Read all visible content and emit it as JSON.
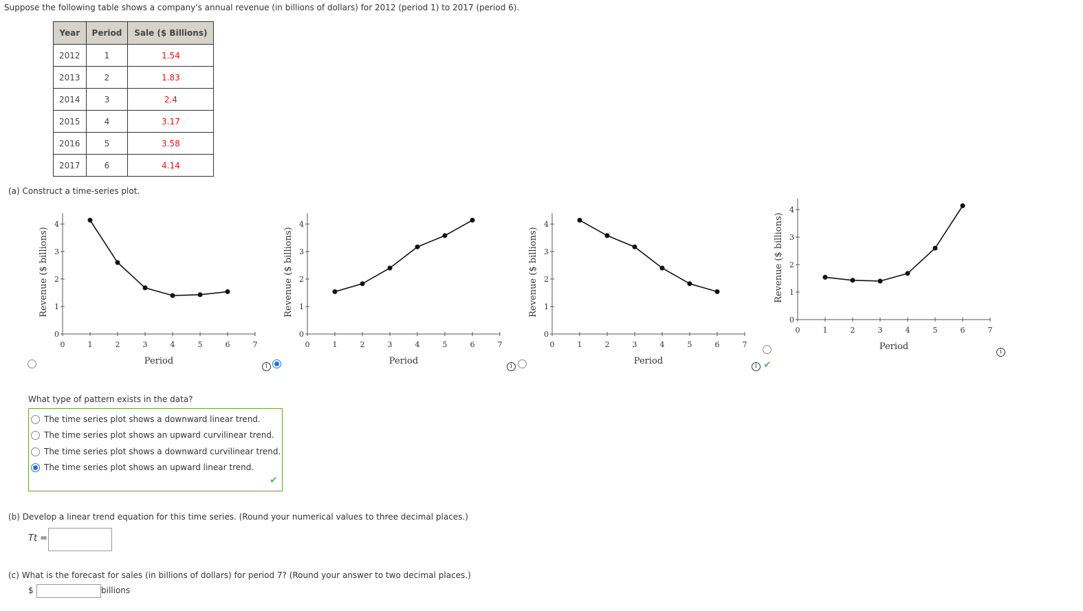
{
  "intro": "Suppose the following table shows a company's annual revenue (in billions of dollars) for 2012 (period 1) to 2017 (period 6).",
  "table": {
    "headers": [
      "Year",
      "Period",
      "Sale ($ Billions)"
    ],
    "rows": [
      [
        "2012",
        "1",
        "1.54"
      ],
      [
        "2013",
        "2",
        "1.83"
      ],
      [
        "2014",
        "3",
        "2.4"
      ],
      [
        "2015",
        "4",
        "3.17"
      ],
      [
        "2016",
        "5",
        "3.58"
      ],
      [
        "2017",
        "6",
        "4.14"
      ]
    ]
  },
  "part_a": {
    "label": "(a)  Construct a time-series plot.",
    "question": "What type of pattern exists in the data?",
    "choices": [
      {
        "text": "The time series plot shows a downward linear trend.",
        "selected": false
      },
      {
        "text": "The time series plot shows an upward curvilinear trend.",
        "selected": false
      },
      {
        "text": "The time series plot shows a downward curvilinear trend.",
        "selected": false
      },
      {
        "text": "The time series plot shows an upward linear trend.",
        "selected": true
      }
    ],
    "result": "correct",
    "plot_options_selected": 2
  },
  "part_b": {
    "label": "(b)  Develop a linear trend equation for this time series. (Round your numerical values to three decimal places.)",
    "var": "Tt =",
    "value": ""
  },
  "part_c": {
    "label": "(c)  What is the forecast for sales (in billions of dollars) for period 7? (Round your answer to two decimal places.)",
    "prefix": "$",
    "suffix": "billions",
    "value": ""
  },
  "colors": {
    "accent": "#1a73e8",
    "correct": "#5cb85c",
    "value_red": "#e0161b",
    "header_bg": "#d6d3ca"
  },
  "chart_data": [
    {
      "type": "line",
      "title": "",
      "xlabel": "Period",
      "ylabel": "Revenue ($ billions)",
      "x": [
        1,
        2,
        3,
        4,
        5,
        6
      ],
      "values": [
        4.14,
        2.6,
        1.68,
        1.4,
        1.43,
        1.54
      ],
      "xlim": [
        0,
        7
      ],
      "ylim": [
        0,
        4
      ],
      "xticks": [
        0,
        1,
        2,
        3,
        4,
        5,
        6,
        7
      ],
      "yticks": [
        0,
        1,
        2,
        3,
        4
      ],
      "selected": false
    },
    {
      "type": "line",
      "title": "",
      "xlabel": "Period",
      "ylabel": "Revenue ($ billions)",
      "x": [
        1,
        2,
        3,
        4,
        5,
        6
      ],
      "values": [
        1.54,
        1.83,
        2.4,
        3.17,
        3.58,
        4.14
      ],
      "xlim": [
        0,
        7
      ],
      "ylim": [
        0,
        4
      ],
      "xticks": [
        0,
        1,
        2,
        3,
        4,
        5,
        6,
        7
      ],
      "yticks": [
        0,
        1,
        2,
        3,
        4
      ],
      "selected": true
    },
    {
      "type": "line",
      "title": "",
      "xlabel": "Period",
      "ylabel": "Revenue ($ billions)",
      "x": [
        1,
        2,
        3,
        4,
        5,
        6
      ],
      "values": [
        4.14,
        3.58,
        3.17,
        2.4,
        1.83,
        1.54
      ],
      "xlim": [
        0,
        7
      ],
      "ylim": [
        0,
        4
      ],
      "xticks": [
        0,
        1,
        2,
        3,
        4,
        5,
        6,
        7
      ],
      "yticks": [
        0,
        1,
        2,
        3,
        4
      ],
      "selected": false
    },
    {
      "type": "line",
      "title": "",
      "xlabel": "Period",
      "ylabel": "Revenue ($ billions)",
      "x": [
        1,
        2,
        3,
        4,
        5,
        6
      ],
      "values": [
        1.54,
        1.43,
        1.4,
        1.68,
        2.6,
        4.14
      ],
      "xlim": [
        0,
        7
      ],
      "ylim": [
        0,
        4
      ],
      "xticks": [
        0,
        1,
        2,
        3,
        4,
        5,
        6,
        7
      ],
      "yticks": [
        0,
        1,
        2,
        3,
        4
      ],
      "selected": false
    }
  ]
}
